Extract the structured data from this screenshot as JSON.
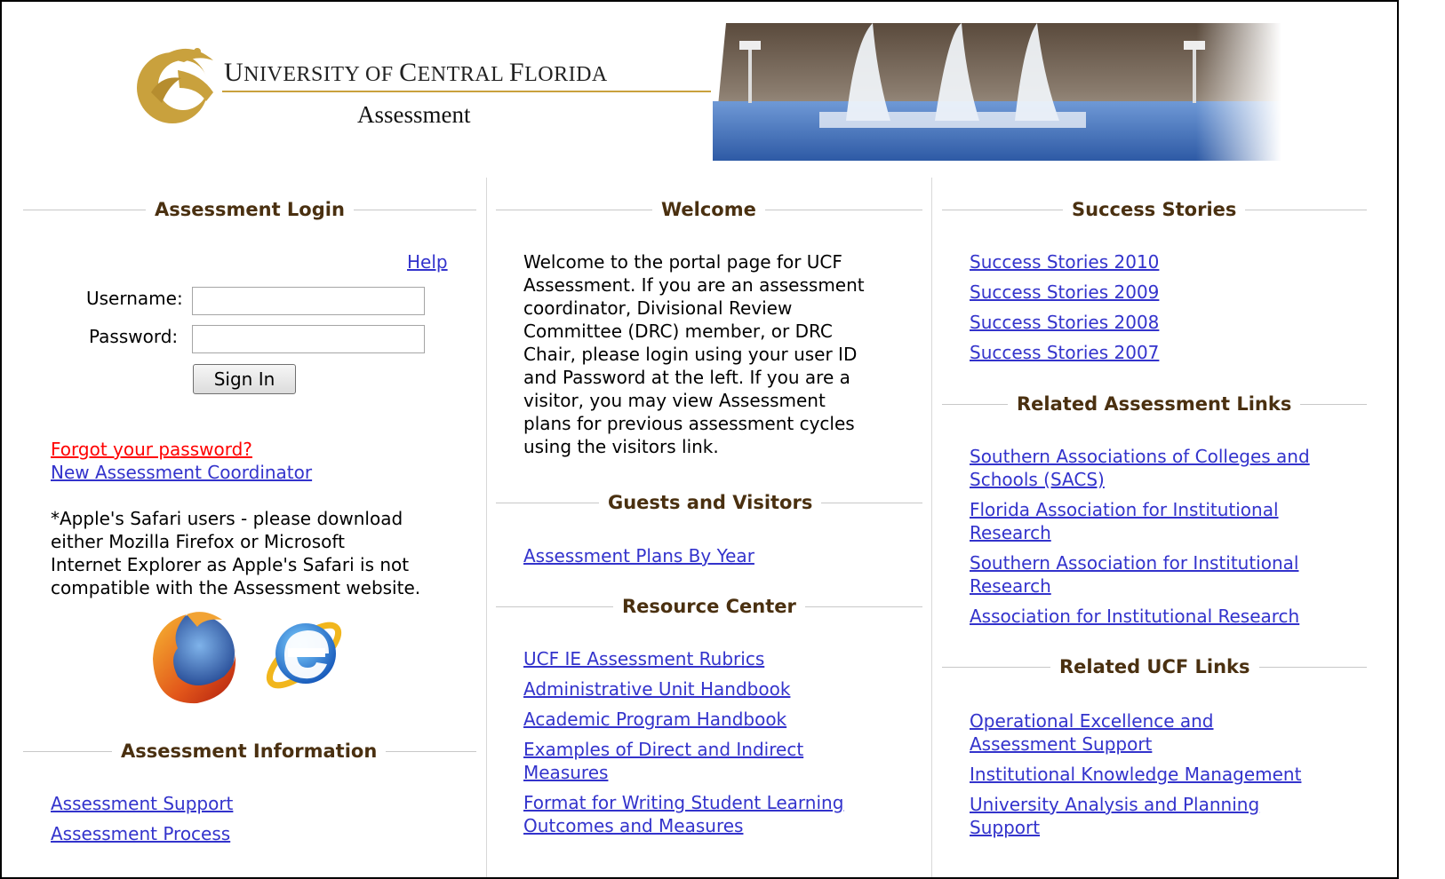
{
  "header": {
    "title_first": "U",
    "title_rest_1": "NIVERSITY OF ",
    "title_c": "C",
    "title_rest_2": "ENTRAL ",
    "title_f": "F",
    "title_rest_3": "LORIDA",
    "subtitle": "Assessment"
  },
  "login": {
    "heading": "Assessment Login",
    "help": "Help",
    "username_label": "Username:",
    "password_label": "Password:",
    "username_value": "",
    "password_value": "",
    "sign_in": "Sign In",
    "forgot": "Forgot your password?",
    "new_coordinator": "New Assessment Coordinator",
    "safari_note_1": "*Apple's Safari users - please download",
    "safari_note_2": "either Mozilla Firefox or Microsoft",
    "safari_note_3": "Internet Explorer as Apple's Safari is not",
    "safari_note_4": "compatible with the Assessment website.",
    "browser_icons": [
      "firefox-icon",
      "internet-explorer-icon"
    ]
  },
  "assessment_info": {
    "heading": "Assessment Information",
    "links": [
      "Assessment Support",
      "Assessment Process"
    ]
  },
  "welcome": {
    "heading": "Welcome",
    "lines": [
      "Welcome to the portal page for UCF",
      "Assessment. If you are an assessment",
      "coordinator, Divisional Review",
      "Committee (DRC) member, or DRC",
      "Chair, please login using your user ID",
      "and Password at the left. If you are a",
      "visitor, you may view Assessment",
      "plans for previous assessment cycles",
      "using the visitors link."
    ]
  },
  "guests": {
    "heading": "Guests and Visitors",
    "link": "Assessment Plans By Year"
  },
  "resource_center": {
    "heading": "Resource Center",
    "links": [
      "UCF IE Assessment Rubrics",
      "Administrative Unit Handbook",
      "Academic Program Handbook",
      "Examples of Direct and Indirect",
      "Measures",
      "Format for Writing Student Learning",
      "Outcomes and Measures"
    ]
  },
  "success_stories": {
    "heading": "Success Stories",
    "links": [
      "Success Stories 2010",
      "Success Stories 2009",
      "Success Stories 2008",
      "Success Stories 2007"
    ]
  },
  "related_assessment": {
    "heading": "Related Assessment Links",
    "links": [
      "Southern Associations of Colleges and",
      "Schools (SACS)",
      "Florida Association for Institutional",
      "Research",
      "Southern Association for Institutional",
      "Research",
      "Association for Institutional Research"
    ]
  },
  "related_ucf": {
    "heading": "Related UCF Links",
    "links": [
      "Operational Excellence and",
      "Assessment Support",
      "Institutional Knowledge Management",
      "University Analysis and Planning",
      "Support"
    ]
  },
  "colors": {
    "link": "#3333cc",
    "forgot_link": "#ff0000",
    "heading": "#4a3010",
    "gold": "#c9a13d"
  }
}
